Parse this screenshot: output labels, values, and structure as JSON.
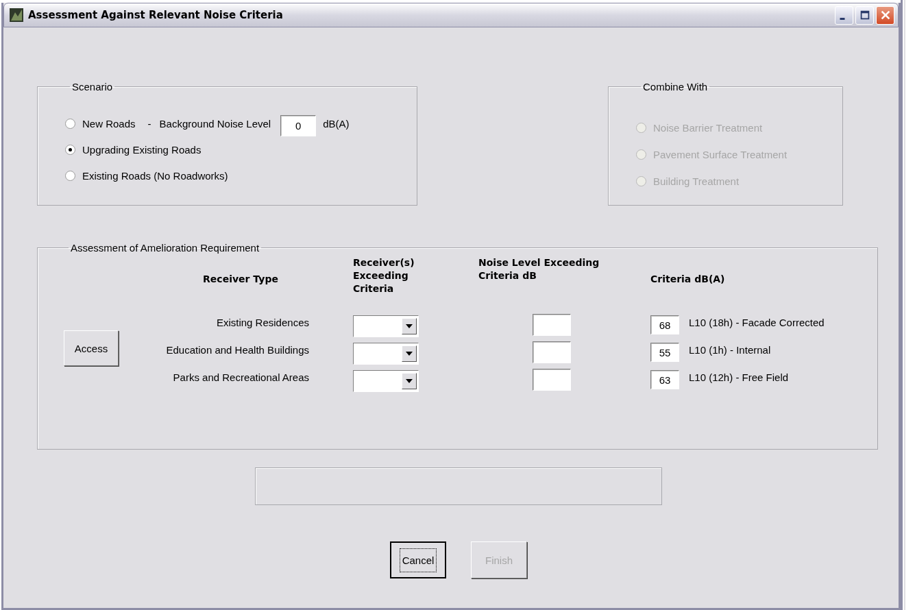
{
  "window": {
    "title": "Assessment Against Relevant Noise Criteria"
  },
  "scenario": {
    "title": "Scenario",
    "separator": "-",
    "background_label": "Background Noise Level",
    "background_value": "0",
    "background_unit": "dB(A)",
    "options": [
      {
        "label": "New Roads",
        "selected": false
      },
      {
        "label": "Upgrading Existing Roads",
        "selected": true
      },
      {
        "label": "Existing Roads (No Roadworks)",
        "selected": false
      }
    ]
  },
  "combine": {
    "title": "Combine With",
    "disabled": true,
    "options": [
      {
        "label": "Noise Barrier Treatment",
        "selected": false
      },
      {
        "label": "Pavement Surface Treatment",
        "selected": false
      },
      {
        "label": "Building Treatment",
        "selected": false
      }
    ]
  },
  "assessment": {
    "title": "Assessment of Amelioration Requirement",
    "access_button": "Access",
    "columns": [
      "Receiver Type",
      "Receiver(s) Exceeding Criteria",
      "Noise Level Exceeding Criteria dB",
      "Criteria dB(A)"
    ],
    "rows": [
      {
        "receiver_type": "Existing Residences",
        "criteria_value": "68",
        "criteria_note": "L10 (18h) - Facade Corrected"
      },
      {
        "receiver_type": "Education and Health Buildings",
        "criteria_value": "55",
        "criteria_note": "L10 (1h) - Internal"
      },
      {
        "receiver_type": "Parks and Recreational Areas",
        "criteria_value": "63",
        "criteria_note": "L10 (12h) - Free Field"
      }
    ]
  },
  "buttons": [
    {
      "label": "Cancel",
      "disabled": false,
      "focused": true
    },
    {
      "label": "Finish",
      "disabled": true,
      "focused": false
    }
  ]
}
